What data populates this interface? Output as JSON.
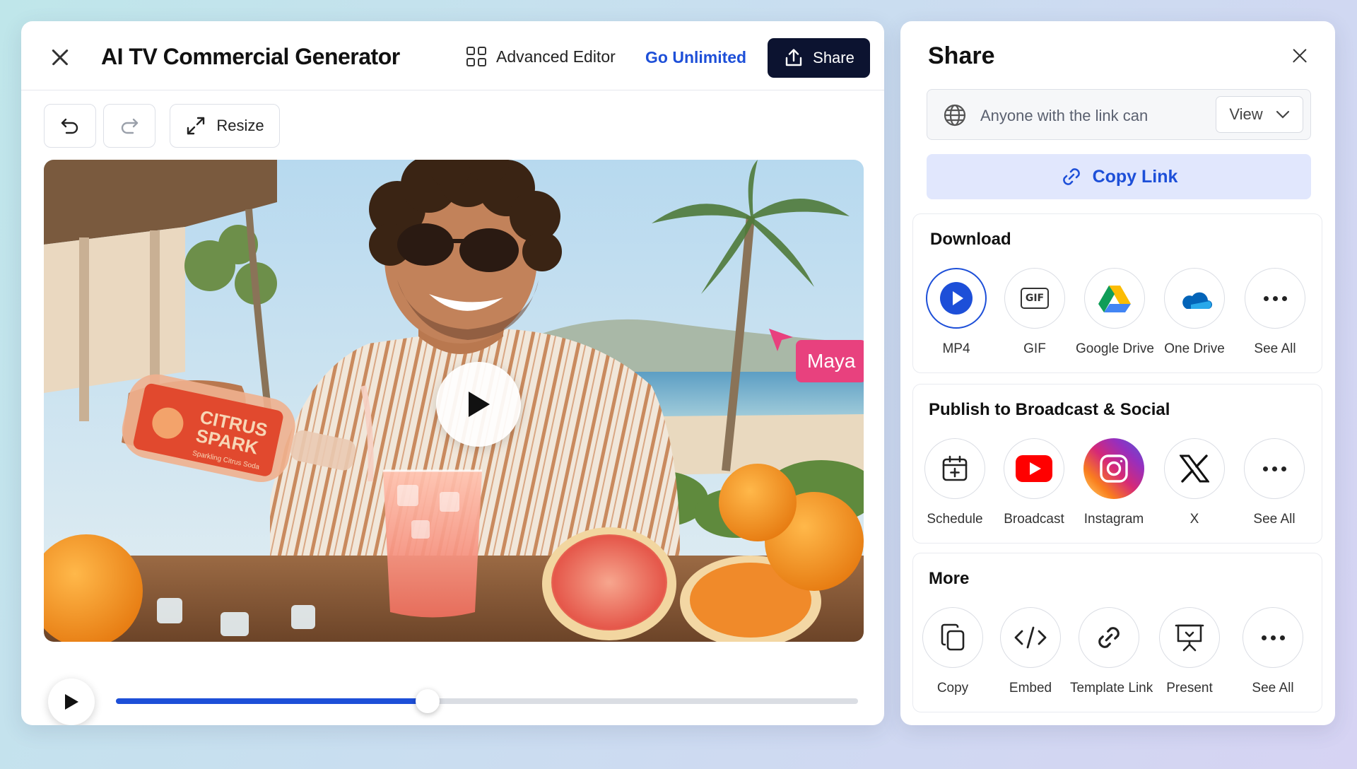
{
  "editor": {
    "title": "AI TV Commercial Generator",
    "advanced_editor_label": "Advanced Editor",
    "go_unlimited_label": "Go Unlimited",
    "share_label": "Share",
    "resize_label": "Resize",
    "accent_color": "#1d4fd8",
    "share_button_color": "#0c1330"
  },
  "video": {
    "cursor_label": "Maya",
    "cursor_color": "#e8417e",
    "progress": 0.42,
    "product_label_line1": "CITRUS",
    "product_label_line2": "SPARK",
    "product_label_line3": "Sparkling Citrus Soda"
  },
  "share_panel": {
    "title": "Share",
    "link_access_label": "Anyone with the link can",
    "permission": "View",
    "copy_link_label": "Copy Link",
    "download": {
      "title": "Download",
      "options": [
        {
          "label": "MP4",
          "icon": "play-icon",
          "selected": true
        },
        {
          "label": "GIF",
          "icon": "gif-icon"
        },
        {
          "label": "Google Drive",
          "icon": "google-drive-icon"
        },
        {
          "label": "One Drive",
          "icon": "onedrive-icon"
        },
        {
          "label": "See All",
          "icon": "more-icon"
        }
      ]
    },
    "publish": {
      "title": "Publish to Broadcast & Social",
      "options": [
        {
          "label": "Schedule",
          "icon": "calendar-add-icon"
        },
        {
          "label": "Broadcast",
          "icon": "youtube-icon"
        },
        {
          "label": "Instagram",
          "icon": "instagram-icon"
        },
        {
          "label": "X",
          "icon": "x-logo-icon"
        },
        {
          "label": "See All",
          "icon": "more-icon"
        }
      ]
    },
    "more": {
      "title": "More",
      "options": [
        {
          "label": "Copy",
          "icon": "copy-icon"
        },
        {
          "label": "Embed",
          "icon": "code-icon"
        },
        {
          "label": "Template Link",
          "icon": "link-icon"
        },
        {
          "label": "Present",
          "icon": "presentation-icon"
        },
        {
          "label": "See All",
          "icon": "more-icon"
        }
      ]
    }
  }
}
